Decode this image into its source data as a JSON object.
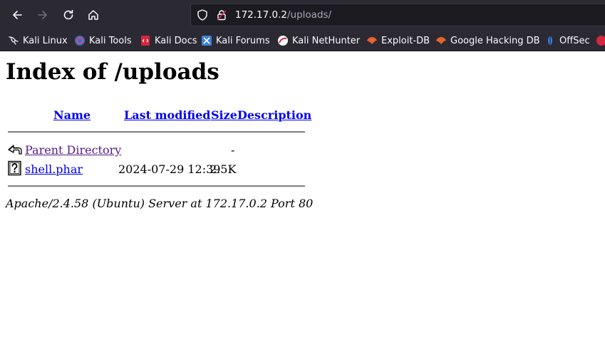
{
  "browser": {
    "url_host": "172.17.0.2",
    "url_path": "/uploads/",
    "bookmarks": [
      {
        "label": "Kali Linux",
        "icon": "kali-dragon-icon"
      },
      {
        "label": "Kali Tools",
        "icon": "kali-tools-icon"
      },
      {
        "label": "Kali Docs",
        "icon": "kali-docs-icon"
      },
      {
        "label": "Kali Forums",
        "icon": "kali-forums-icon"
      },
      {
        "label": "Kali NetHunter",
        "icon": "nethunter-icon"
      },
      {
        "label": "Exploit-DB",
        "icon": "exploit-db-icon"
      },
      {
        "label": "Google Hacking DB",
        "icon": "ghdb-icon"
      },
      {
        "label": "OffSec",
        "icon": "offsec-icon"
      }
    ]
  },
  "page": {
    "title": "Index of /uploads",
    "columns": {
      "name": "Name",
      "last_modified": "Last modified",
      "size": "Size",
      "description": "Description"
    },
    "rows": [
      {
        "icon": "back-arrow-icon",
        "name": "Parent Directory",
        "last_modified": "",
        "size": "-",
        "description": ""
      },
      {
        "icon": "unknown-file-icon",
        "name": "shell.phar",
        "last_modified": "2024-07-29 12:39",
        "size": "2.5K",
        "description": ""
      }
    ],
    "footer": "Apache/2.4.58 (Ubuntu) Server at 172.17.0.2 Port 80"
  }
}
